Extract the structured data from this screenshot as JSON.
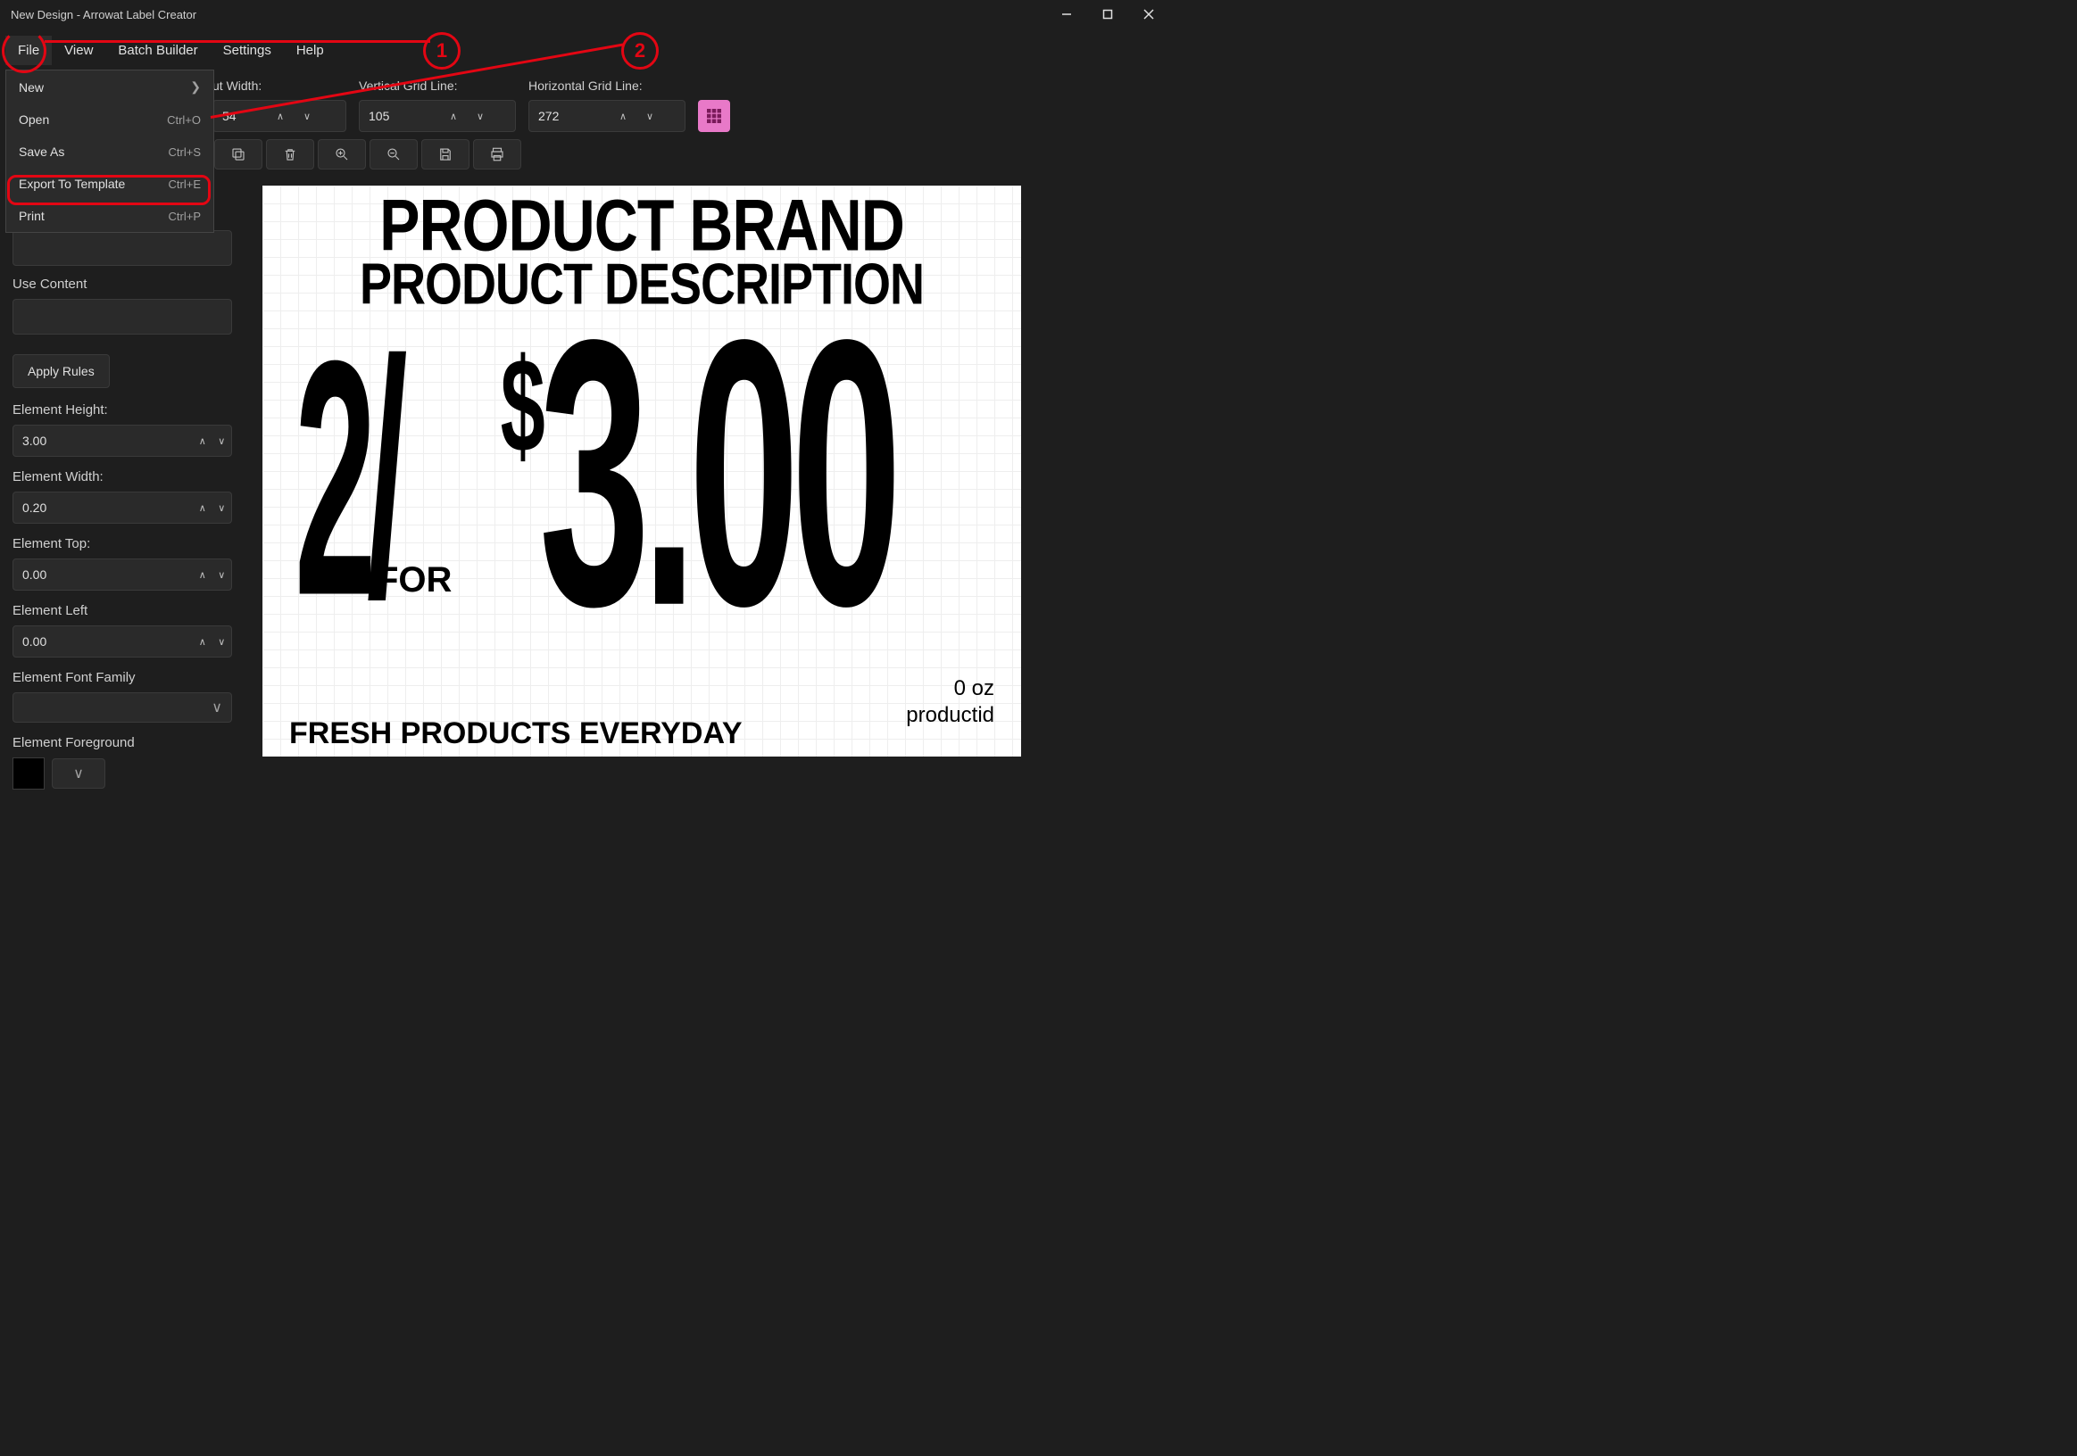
{
  "window": {
    "title": "New Design - Arrowat Label Creator"
  },
  "menubar": {
    "items": [
      "File",
      "View",
      "Batch Builder",
      "Settings",
      "Help"
    ]
  },
  "file_menu": {
    "items": [
      {
        "label": "New",
        "shortcut": "",
        "arrow": true
      },
      {
        "label": "Open",
        "shortcut": "Ctrl+O",
        "arrow": false
      },
      {
        "label": "Save As",
        "shortcut": "Ctrl+S",
        "arrow": false
      },
      {
        "label": "Export To Template",
        "shortcut": "Ctrl+E",
        "arrow": false
      },
      {
        "label": "Print",
        "shortcut": "Ctrl+P",
        "arrow": false
      }
    ]
  },
  "toolbar": {
    "layout_width": {
      "label": "ut Width:",
      "value": "54"
    },
    "vgrid": {
      "label": "Vertical Grid Line:",
      "value": "105"
    },
    "hgrid": {
      "label": "Horizontal Grid Line:",
      "value": "272"
    }
  },
  "sidebar": {
    "use_content_label": "Use Content",
    "apply_rules_label": "Apply Rules",
    "element_height": {
      "label": "Element Height:",
      "value": "3.00"
    },
    "element_width": {
      "label": "Element Width:",
      "value": "0.20"
    },
    "element_top": {
      "label": "Element Top:",
      "value": "0.00"
    },
    "element_left": {
      "label": "Element Left",
      "value": "0.00"
    },
    "element_font": {
      "label": "Element Font Family"
    },
    "element_fg": {
      "label": "Element Foreground"
    }
  },
  "label": {
    "brand": "PRODUCT BRAND",
    "description": "PRODUCT DESCRIPTION",
    "qty_slash": "2/",
    "for": "FOR",
    "dollar": "$",
    "price": "3.00",
    "size": "0 oz",
    "productid": "productid",
    "slogan": "FRESH PRODUCTS EVERYDAY"
  },
  "annotations": {
    "one": "1",
    "two": "2"
  }
}
